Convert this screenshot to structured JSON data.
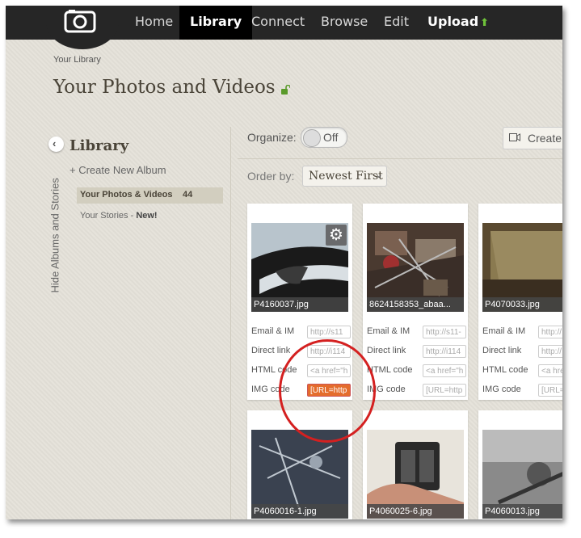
{
  "nav": {
    "items": [
      {
        "label": "Home"
      },
      {
        "label": "Library"
      },
      {
        "label": "Connect"
      },
      {
        "label": "Browse"
      },
      {
        "label": "Edit"
      },
      {
        "label": "Upload"
      }
    ],
    "upload_icon": "arrow-up-icon"
  },
  "breadcrumb": "Your Library",
  "page_title": "Your Photos and Videos",
  "sidebar": {
    "hide_label": "Hide Albums and Stories",
    "title": "Library",
    "create_album": "+ Create New Album",
    "photos_label": "Your Photos & Videos",
    "photos_count": "44",
    "stories_label": "Your Stories -",
    "stories_new": "New!"
  },
  "toolbar": {
    "organize_label": "Organize:",
    "organize_state": "Off",
    "create_label": "Create",
    "orderby_label": "Order by:",
    "orderby_value": "Newest First"
  },
  "field_labels": [
    "Email & IM",
    "Direct link",
    "HTML code",
    "IMG code"
  ],
  "cards": [
    {
      "caption": "P4160037.jpg",
      "fields": [
        "http://s11",
        "http://i114",
        "<a href=\"h",
        "[URL=http"
      ]
    },
    {
      "caption": "8624158353_abaa...",
      "fields": [
        "http://s11-",
        "http://i114",
        "<a href=\"h",
        "[URL=http"
      ]
    },
    {
      "caption": "P4070033.jpg",
      "fields": [
        "http://",
        "http://",
        "<a href",
        "[URL="
      ]
    },
    {
      "caption": "P4060016-1.jpg"
    },
    {
      "caption": "P4060025-6.jpg"
    },
    {
      "caption": "P4060013.jpg"
    }
  ],
  "colors": {
    "nav_bg": "#262626",
    "page_bg": "#e4e1d9",
    "selected_field": "#e46c2c",
    "annotation": "#d42020",
    "upload_arrow": "#6fc23a"
  }
}
